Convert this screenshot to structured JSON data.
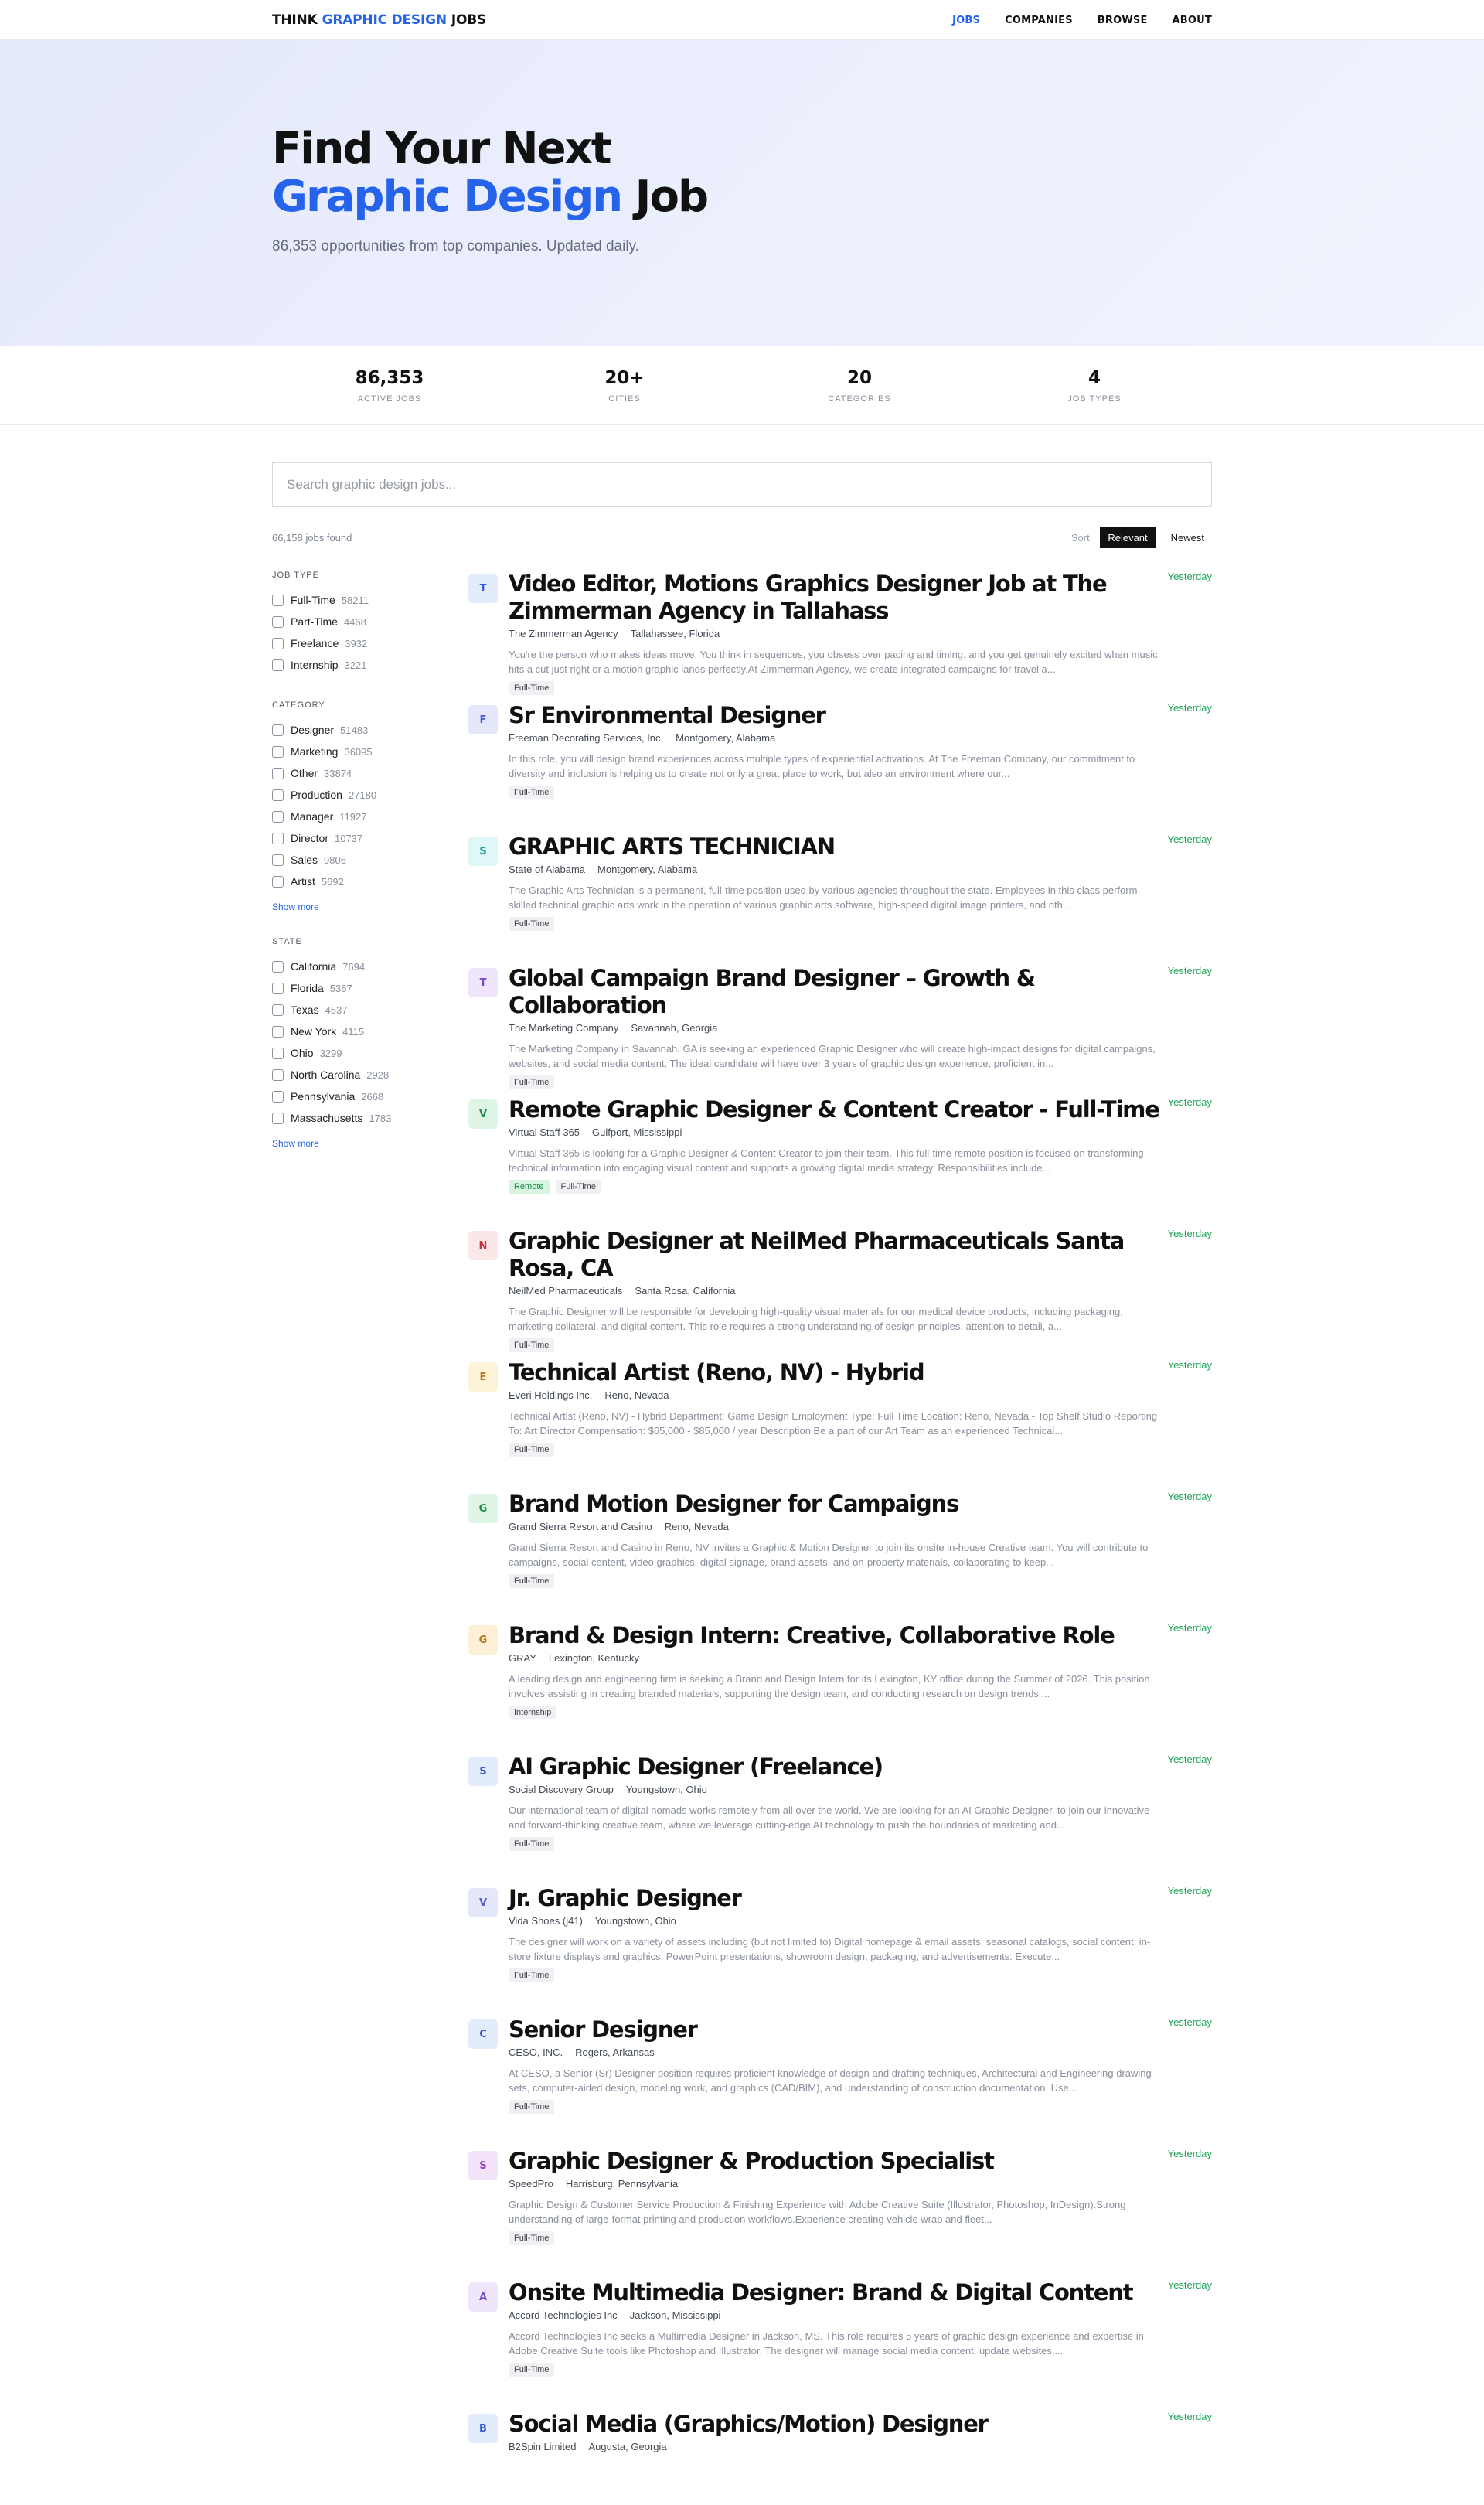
{
  "nav": {
    "logo": {
      "part1": "THINK",
      "part2": "GRAPHIC DESIGN",
      "part3": "JOBS"
    },
    "links": [
      "JOBS",
      "COMPANIES",
      "BROWSE",
      "ABOUT"
    ]
  },
  "hero": {
    "line1": "Find Your Next",
    "line2_accent": "Graphic Design",
    "line2_rest": "Job",
    "subtitle": "86,353 opportunities from top companies. Updated daily."
  },
  "stats": [
    {
      "value": "86,353",
      "label": "ACTIVE JOBS"
    },
    {
      "value": "20+",
      "label": "CITIES"
    },
    {
      "value": "20",
      "label": "CATEGORIES"
    },
    {
      "value": "4",
      "label": "JOB TYPES"
    }
  ],
  "search": {
    "placeholder": "Search graphic design jobs..."
  },
  "results": {
    "found": "66,158 jobs found",
    "sort_label": "Sort:",
    "sort_options": [
      "Relevant",
      "Newest"
    ]
  },
  "filters": {
    "job_type": {
      "title": "JOB TYPE",
      "items": [
        {
          "label": "Full-Time",
          "count": "58211"
        },
        {
          "label": "Part-Time",
          "count": "4468"
        },
        {
          "label": "Freelance",
          "count": "3932"
        },
        {
          "label": "Internship",
          "count": "3221"
        }
      ]
    },
    "category": {
      "title": "CATEGORY",
      "items": [
        {
          "label": "Designer",
          "count": "51483"
        },
        {
          "label": "Marketing",
          "count": "36095"
        },
        {
          "label": "Other",
          "count": "33874"
        },
        {
          "label": "Production",
          "count": "27180"
        },
        {
          "label": "Manager",
          "count": "11927"
        },
        {
          "label": "Director",
          "count": "10737"
        },
        {
          "label": "Sales",
          "count": "9806"
        },
        {
          "label": "Artist",
          "count": "5692"
        }
      ],
      "show_more": "Show more"
    },
    "state": {
      "title": "STATE",
      "items": [
        {
          "label": "California",
          "count": "7694"
        },
        {
          "label": "Florida",
          "count": "5367"
        },
        {
          "label": "Texas",
          "count": "4537"
        },
        {
          "label": "New York",
          "count": "4115"
        },
        {
          "label": "Ohio",
          "count": "3299"
        },
        {
          "label": "North Carolina",
          "count": "2928"
        },
        {
          "label": "Pennsylvania",
          "count": "2668"
        },
        {
          "label": "Massachusetts",
          "count": "1783"
        }
      ],
      "show_more": "Show more"
    }
  },
  "jobs": [
    {
      "initial": "T",
      "bg": "#e3ecfb",
      "fg": "#3b5bdb",
      "title": "Video Editor, Motions Graphics Designer Job at The Zimmerman Agency in Tallahass",
      "company": "The Zimmerman Agency",
      "location": "Tallahassee, Florida",
      "desc": "You're the person who makes ideas move. You think in sequences, you obsess over pacing and timing, and you get genuinely excited when music hits a cut just right or a motion graphic lands perfectly.At Zimmerman Agency, we create integrated campaigns for travel a...",
      "tags": [
        "Full-Time"
      ],
      "date": "Yesterday"
    },
    {
      "initial": "F",
      "bg": "#e5e8fb",
      "fg": "#4c5bd4",
      "title": "Sr Environmental Designer",
      "company": "Freeman Decorating Services, Inc.",
      "location": "Montgomery, Alabama",
      "desc": "In this role, you will design brand experiences across multiple types of experiential activations. At The Freeman Company, our commitment to diversity and inclusion is helping us to create not only a great place to work, but also an environment where our...",
      "tags": [
        "Full-Time"
      ],
      "date": "Yesterday"
    },
    {
      "initial": "S",
      "bg": "#dff7f7",
      "fg": "#1a9a9a",
      "title": "GRAPHIC ARTS TECHNICIAN",
      "company": "State of Alabama",
      "location": "Montgomery, Alabama",
      "desc": "The Graphic Arts Technician is a permanent, full-time position used by various agencies throughout the state. Employees in this class perform skilled technical graphic arts work in the operation of various graphic arts software, high-speed digital image printers, and oth...",
      "tags": [
        "Full-Time"
      ],
      "date": "Yesterday"
    },
    {
      "initial": "T",
      "bg": "#efe6fb",
      "fg": "#7b4bcf",
      "title": "Global Campaign Brand Designer – Growth & Collaboration",
      "company": "The Marketing Company",
      "location": "Savannah, Georgia",
      "desc": "The Marketing Company in Savannah, GA is seeking an experienced Graphic Designer who will create high-impact designs for digital campaigns, websites, and social media content. The ideal candidate will have over 3 years of graphic design experience, proficient in...",
      "tags": [
        "Full-Time"
      ],
      "date": "Yesterday"
    },
    {
      "initial": "V",
      "bg": "#dff5e6",
      "fg": "#1f8f4a",
      "title": "Remote Graphic Designer & Content Creator - Full-Time",
      "company": "Virtual Staff 365",
      "location": "Gulfport, Mississippi",
      "desc": "Virtual Staff 365 is looking for a Graphic Designer & Content Creator to join their team. This full-time remote position is focused on transforming technical information into engaging visual content and supports a growing digital media strategy. Responsibilities include...",
      "tags": [
        "Remote",
        "Full-Time"
      ],
      "date": "Yesterday"
    },
    {
      "initial": "N",
      "bg": "#fbe6e8",
      "fg": "#c9343e",
      "title": "Graphic Designer at NeilMed Pharmaceuticals Santa Rosa, CA",
      "company": "NeilMed Pharmaceuticals",
      "location": "Santa Rosa, California",
      "desc": "The Graphic Designer will be responsible for developing high-quality visual materials for our medical device products, including packaging, marketing collateral, and digital content. This role requires a strong understanding of design principles, attention to detail, a...",
      "tags": [
        "Full-Time"
      ],
      "date": "Yesterday"
    },
    {
      "initial": "E",
      "bg": "#fdf3d9",
      "fg": "#b7791f",
      "title": "Technical Artist (Reno, NV) - Hybrid",
      "company": "Everi Holdings Inc.",
      "location": "Reno, Nevada",
      "desc": "Technical Artist (Reno, NV) - Hybrid Department: Game Design Employment Type: Full Time Location: Reno, Nevada - Top Shelf Studio Reporting To: Art Director Compensation: $65,000 - $85,000 / year Description Be a part of our Art Team as an experienced Technical...",
      "tags": [
        "Full-Time"
      ],
      "date": "Yesterday"
    },
    {
      "initial": "G",
      "bg": "#dff5e6",
      "fg": "#1f8f4a",
      "title": "Brand Motion Designer for Campaigns",
      "company": "Grand Sierra Resort and Casino",
      "location": "Reno, Nevada",
      "desc": "Grand Sierra Resort and Casino in Reno, NV invites a Graphic & Motion Designer to join its onsite in-house Creative team. You will contribute to campaigns, social content, video graphics, digital signage, brand assets, and on-property materials, collaborating to keep...",
      "tags": [
        "Full-Time"
      ],
      "date": "Yesterday"
    },
    {
      "initial": "G",
      "bg": "#fdf0d6",
      "fg": "#b7791f",
      "title": "Brand & Design Intern: Creative, Collaborative Role",
      "company": "GRAY",
      "location": "Lexington, Kentucky",
      "desc": "A leading design and engineering firm is seeking a Brand and Design Intern for its Lexington, KY office during the Summer of 2026. This position involves assisting in creating branded materials, supporting the design team, and conducting research on design trends....",
      "tags": [
        "Internship"
      ],
      "date": "Yesterday"
    },
    {
      "initial": "S",
      "bg": "#e3ecfb",
      "fg": "#3b5bdb",
      "title": "AI Graphic Designer (Freelance)",
      "company": "Social Discovery Group",
      "location": "Youngstown, Ohio",
      "desc": "Our international team of digital nomads works remotely from all over the world. We are looking for an AI Graphic Designer, to join our innovative and forward-thinking creative team, where we leverage cutting-edge AI technology to push the boundaries of marketing and...",
      "tags": [
        "Full-Time"
      ],
      "date": "Yesterday"
    },
    {
      "initial": "V",
      "bg": "#e5e8fb",
      "fg": "#4c5bd4",
      "title": "Jr. Graphic Designer",
      "company": "Vida Shoes (j41)",
      "location": "Youngstown, Ohio",
      "desc": "The designer will work on a variety of assets including (but not limited to) Digital homepage & email assets, seasonal catalogs, social content, in-store fixture displays and graphics, PowerPoint presentations, showroom design, packaging, and advertisements: Execute...",
      "tags": [
        "Full-Time"
      ],
      "date": "Yesterday"
    },
    {
      "initial": "C",
      "bg": "#e3ecfb",
      "fg": "#3b5bdb",
      "title": "Senior Designer",
      "company": "CESO, INC.",
      "location": "Rogers, Arkansas",
      "desc": "At CESO, a Senior (Sr) Designer position requires proficient knowledge of design and drafting techniques, Architectural and Engineering drawing sets, computer-aided design, modeling work, and graphics (CAD/BIM), and understanding of construction documentation. Use...",
      "tags": [
        "Full-Time"
      ],
      "date": "Yesterday"
    },
    {
      "initial": "S",
      "bg": "#f3e4fa",
      "fg": "#9a3fc4",
      "title": "Graphic Designer & Production Specialist",
      "company": "SpeedPro",
      "location": "Harrisburg, Pennsylvania",
      "desc": "Graphic Design & Customer Service Production & Finishing Experience with Adobe Creative Suite (Illustrator, Photoshop, InDesign).Strong understanding of large-format printing and production workflows.Experience creating vehicle wrap and fleet...",
      "tags": [
        "Full-Time"
      ],
      "date": "Yesterday"
    },
    {
      "initial": "A",
      "bg": "#efe6fb",
      "fg": "#7b4bcf",
      "title": "Onsite Multimedia Designer: Brand & Digital Content",
      "company": "Accord Technologies Inc",
      "location": "Jackson, Mississippi",
      "desc": "Accord Technologies Inc seeks a Multimedia Designer in Jackson, MS. This role requires 5 years of graphic design experience and expertise in Adobe Creative Suite tools like Photoshop and Illustrator. The designer will manage social media content, update websites,...",
      "tags": [
        "Full-Time"
      ],
      "date": "Yesterday"
    },
    {
      "initial": "B",
      "bg": "#e3ecfb",
      "fg": "#3b5bdb",
      "title": "Social Media (Graphics/Motion) Designer",
      "company": "B2Spin Limited",
      "location": "Augusta, Georgia",
      "desc": "",
      "tags": [],
      "date": "Yesterday"
    }
  ]
}
